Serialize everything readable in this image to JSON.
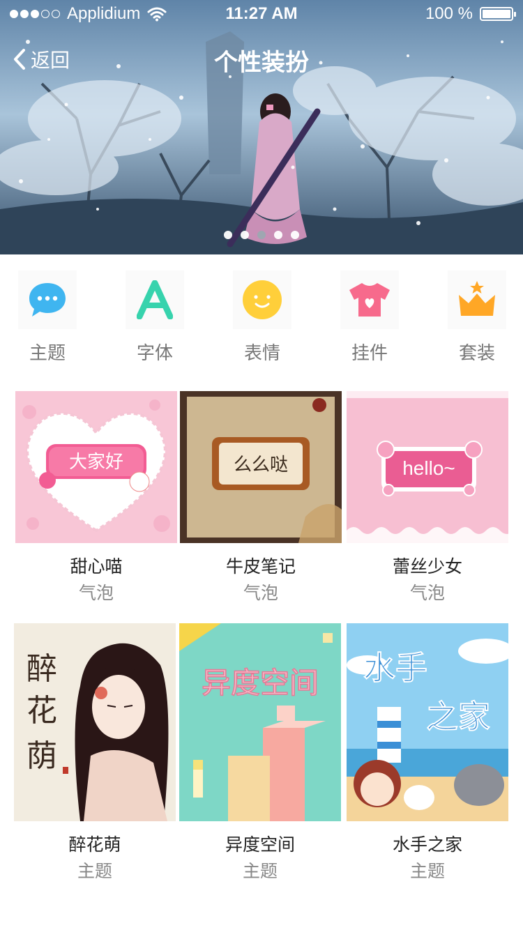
{
  "status_bar": {
    "carrier": "Applidium",
    "time": "11:27 AM",
    "battery": "100 %"
  },
  "nav": {
    "back_label": "返回",
    "title": "个性装扮"
  },
  "banner": {
    "page_count": 5,
    "active_page": 3
  },
  "categories": [
    {
      "label": "主题",
      "icon": "chat-bubble-icon",
      "color": "#3fb5f0"
    },
    {
      "label": "字体",
      "icon": "letter-a-icon",
      "color": "#37d3ad"
    },
    {
      "label": "表情",
      "icon": "smiley-icon",
      "color": "#ffcf3a"
    },
    {
      "label": "挂件",
      "icon": "tshirt-heart-icon",
      "color": "#f76a8c"
    },
    {
      "label": "套装",
      "icon": "crown-icon",
      "color": "#ffa726"
    }
  ],
  "items": [
    {
      "name": "甜心喵",
      "kind": "气泡",
      "image_text": "大家好"
    },
    {
      "name": "牛皮笔记",
      "kind": "气泡",
      "image_text": "么么哒"
    },
    {
      "name": "蕾丝少女",
      "kind": "气泡",
      "image_text": "hello~"
    },
    {
      "name": "醉花萌",
      "kind": "主题",
      "image_text": "醉花荫"
    },
    {
      "name": "异度空间",
      "kind": "主题",
      "image_text": "异度空间"
    },
    {
      "name": "水手之家",
      "kind": "主题",
      "image_text": "水手之家"
    }
  ]
}
